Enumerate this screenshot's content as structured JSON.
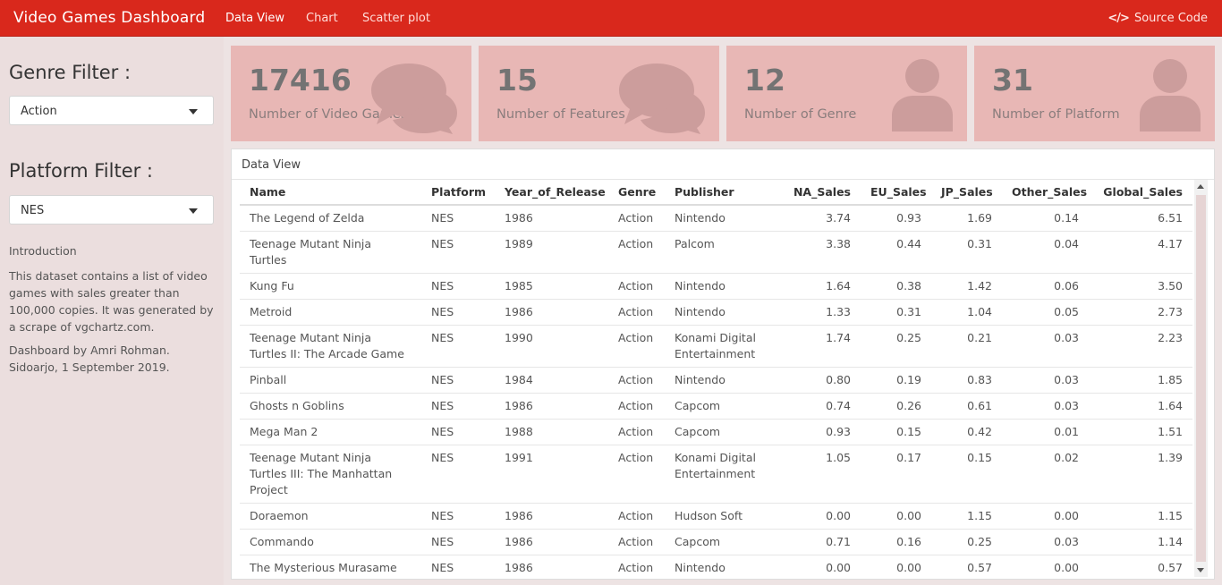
{
  "header": {
    "title": "Video Games Dashboard",
    "nav": [
      {
        "label": "Data View",
        "active": true
      },
      {
        "label": "Chart",
        "active": false
      },
      {
        "label": "Scatter plot",
        "active": false
      }
    ],
    "source_label": "Source Code",
    "source_icon": "code-icon",
    "accent_color": "#d9281c"
  },
  "sidebar": {
    "genre_label": "Genre Filter :",
    "genre_value": "Action",
    "platform_label": "Platform Filter :",
    "platform_value": "NES",
    "intro_title": "Introduction",
    "intro_text": "This dataset contains a list of video games with sales greater than 100,000 copies. It was generated by a scrape of vgchartz.com.",
    "credit": "Dashboard by Amri Rohman. Sidoarjo, 1 September 2019."
  },
  "value_boxes": [
    {
      "value": "17416",
      "caption": "Number of Video Games",
      "icon": "comments-icon"
    },
    {
      "value": "15",
      "caption": "Number of Features",
      "icon": "comments-icon"
    },
    {
      "value": "12",
      "caption": "Number of Genre",
      "icon": "user-icon"
    },
    {
      "value": "31",
      "caption": "Number of Platform",
      "icon": "user-icon"
    }
  ],
  "data_view": {
    "title": "Data View",
    "columns": [
      "Name",
      "Platform",
      "Year_of_Release",
      "Genre",
      "Publisher",
      "NA_Sales",
      "EU_Sales",
      "JP_Sales",
      "Other_Sales",
      "Global_Sales"
    ],
    "rows": [
      [
        "The Legend of Zelda",
        "NES",
        "1986",
        "Action",
        "Nintendo",
        "3.74",
        "0.93",
        "1.69",
        "0.14",
        "6.51"
      ],
      [
        "Teenage Mutant Ninja Turtles",
        "NES",
        "1989",
        "Action",
        "Palcom",
        "3.38",
        "0.44",
        "0.31",
        "0.04",
        "4.17"
      ],
      [
        "Kung Fu",
        "NES",
        "1985",
        "Action",
        "Nintendo",
        "1.64",
        "0.38",
        "1.42",
        "0.06",
        "3.50"
      ],
      [
        "Metroid",
        "NES",
        "1986",
        "Action",
        "Nintendo",
        "1.33",
        "0.31",
        "1.04",
        "0.05",
        "2.73"
      ],
      [
        "Teenage Mutant Ninja Turtles II: The Arcade Game",
        "NES",
        "1990",
        "Action",
        "Konami Digital Entertainment",
        "1.74",
        "0.25",
        "0.21",
        "0.03",
        "2.23"
      ],
      [
        "Pinball",
        "NES",
        "1984",
        "Action",
        "Nintendo",
        "0.80",
        "0.19",
        "0.83",
        "0.03",
        "1.85"
      ],
      [
        "Ghosts n Goblins",
        "NES",
        "1986",
        "Action",
        "Capcom",
        "0.74",
        "0.26",
        "0.61",
        "0.03",
        "1.64"
      ],
      [
        "Mega Man 2",
        "NES",
        "1988",
        "Action",
        "Capcom",
        "0.93",
        "0.15",
        "0.42",
        "0.01",
        "1.51"
      ],
      [
        "Teenage Mutant Ninja Turtles III: The Manhattan Project",
        "NES",
        "1991",
        "Action",
        "Konami Digital Entertainment",
        "1.05",
        "0.17",
        "0.15",
        "0.02",
        "1.39"
      ],
      [
        "Doraemon",
        "NES",
        "1986",
        "Action",
        "Hudson Soft",
        "0.00",
        "0.00",
        "1.15",
        "0.00",
        "1.15"
      ],
      [
        "Commando",
        "NES",
        "1986",
        "Action",
        "Capcom",
        "0.71",
        "0.16",
        "0.25",
        "0.03",
        "1.14"
      ],
      [
        "The Mysterious Murasame Castle",
        "NES",
        "1986",
        "Action",
        "Nintendo",
        "0.00",
        "0.00",
        "0.57",
        "0.00",
        "0.57"
      ]
    ]
  }
}
